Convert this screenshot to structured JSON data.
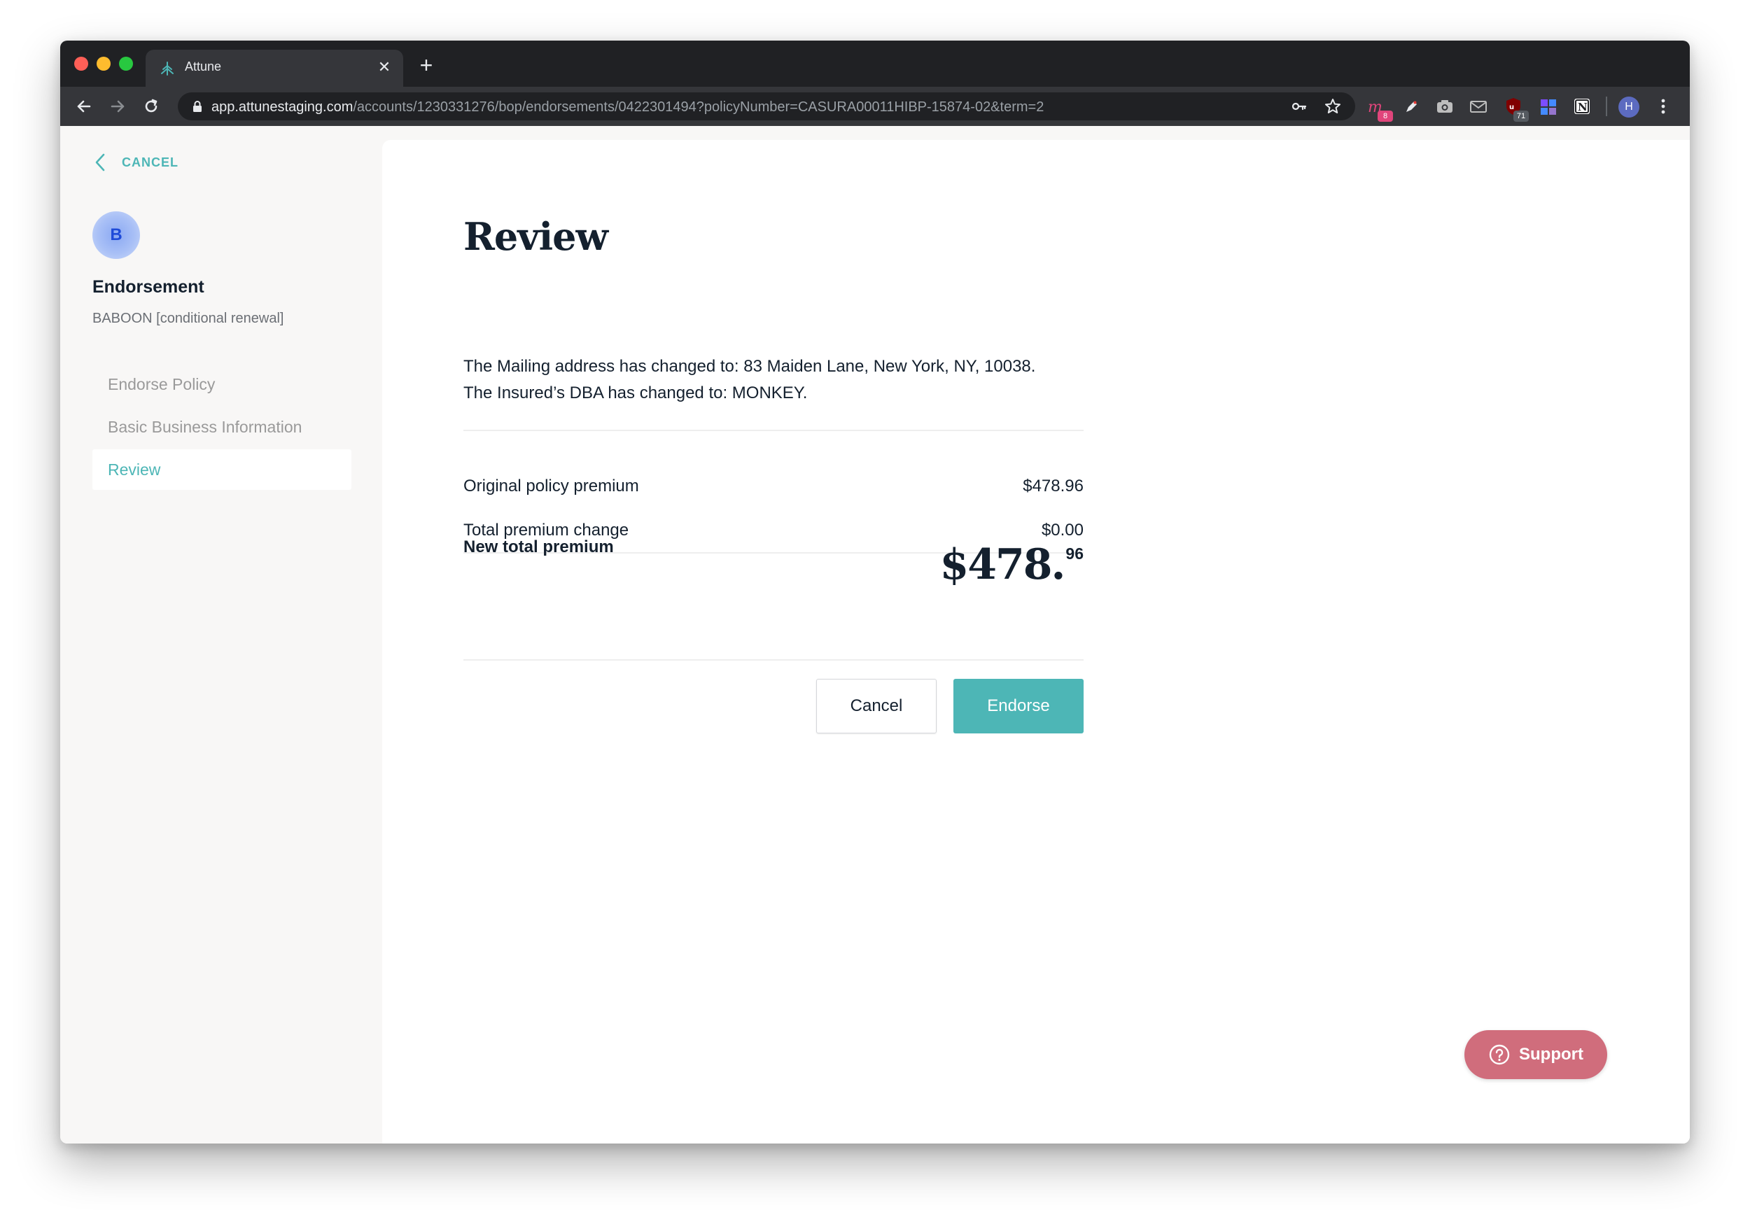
{
  "browser": {
    "tab_title": "Attune",
    "url_host": "app.attunestaging.com",
    "url_path": "/accounts/1230331276/bop/endorsements/0422301494?policyNumber=CASURA00011HIBP-15874-02&term=2",
    "profile_initial": "H",
    "extensions": [
      {
        "name": "m-extension-icon",
        "badge": "8"
      },
      {
        "name": "pen-extension-icon",
        "badge": ""
      },
      {
        "name": "camera-extension-icon",
        "badge": ""
      },
      {
        "name": "mail-extension-icon",
        "badge": ""
      },
      {
        "name": "ublock-extension-icon",
        "badge": "71"
      },
      {
        "name": "grid-extension-icon",
        "badge": ""
      },
      {
        "name": "notion-extension-icon",
        "badge": ""
      }
    ]
  },
  "sidebar": {
    "cancel_label": "CANCEL",
    "avatar_letter": "B",
    "title": "Endorsement",
    "subtitle": "BABOON [conditional renewal]",
    "steps": [
      {
        "label": "Endorse Policy",
        "active": false
      },
      {
        "label": "Basic Business Information",
        "active": false
      },
      {
        "label": "Review",
        "active": true
      }
    ]
  },
  "review": {
    "title": "Review",
    "changes": [
      "The Mailing address has changed to: 83 Maiden Lane, New York, NY, 10038.",
      "The Insured’s DBA has changed to: MONKEY."
    ],
    "original_label": "Original policy premium",
    "original_value": "$478.96",
    "change_label": "Total premium change",
    "change_value": "$0.00",
    "new_total_label": "New total premium",
    "new_total_main": "$478.",
    "new_total_cents": "96",
    "cancel_button": "Cancel",
    "endorse_button": "Endorse"
  },
  "support_button": "Support",
  "colors": {
    "accent": "#4db6b6",
    "support": "#d06d7c",
    "text_dark": "#14202e",
    "chrome_dark": "#202124"
  }
}
